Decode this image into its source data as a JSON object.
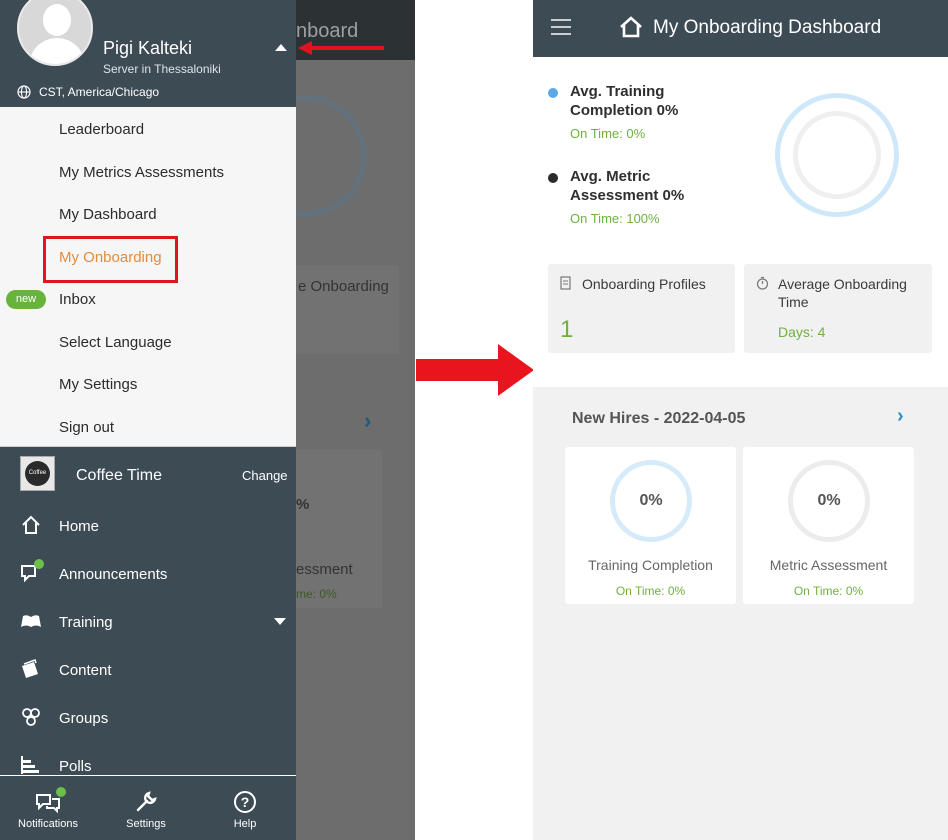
{
  "background_app": {
    "header_title_fragment": "nboard",
    "tile_fragment": "e Onboarding",
    "ring_fragment": "%",
    "label_fragment": "essment",
    "sub_fragment": "me: 0%"
  },
  "drawer": {
    "profile": {
      "name": "Pigi Kalteki",
      "server": "Server in Thessaloniki",
      "timezone": "CST, America/Chicago"
    },
    "menu_items": [
      {
        "label": "Leaderboard"
      },
      {
        "label": "My Metrics Assessments"
      },
      {
        "label": "My Dashboard"
      },
      {
        "label": "My Onboarding",
        "active": true,
        "highlighted": true
      },
      {
        "label": "Inbox",
        "badge": "new"
      },
      {
        "label": "Select Language"
      },
      {
        "label": "My Settings"
      },
      {
        "label": "Sign out"
      }
    ],
    "workspace": {
      "logo_text": "Coffee",
      "name": "Coffee Time",
      "change_label": "Change"
    },
    "nav_items": [
      {
        "label": "Home",
        "icon": "home-icon"
      },
      {
        "label": "Announcements",
        "icon": "megaphone-icon",
        "has_dot": true
      },
      {
        "label": "Training",
        "icon": "book-icon",
        "has_caret": true
      },
      {
        "label": "Content",
        "icon": "folder-icon"
      },
      {
        "label": "Groups",
        "icon": "groups-icon"
      },
      {
        "label": "Polls",
        "icon": "poll-icon"
      }
    ],
    "bottom_bar": [
      {
        "label": "Notifications",
        "icon": "chat-bubbles-icon"
      },
      {
        "label": "Settings",
        "icon": "wrench-icon"
      },
      {
        "label": "Help",
        "icon": "question-icon"
      }
    ]
  },
  "dashboard": {
    "title": "My Onboarding Dashboard",
    "stats": [
      {
        "title": "Avg. Training Completion 0%",
        "sub": "On Time: 0%",
        "dot_color": "#5aa9e6"
      },
      {
        "title": "Avg. Metric Assessment 0%",
        "sub": "On Time: 100%",
        "dot_color": "#2b2b2b"
      }
    ],
    "tiles": [
      {
        "label": "Onboarding Profiles",
        "value": "1"
      },
      {
        "label": "Average Onboarding Time",
        "value": "Days: 4"
      }
    ],
    "section": {
      "title": "New Hires - 2022-04-05",
      "cards": [
        {
          "value": "0%",
          "label": "Training Completion",
          "sub": "On Time: 0%"
        },
        {
          "value": "0%",
          "label": "Metric Assessment",
          "sub": "On Time: 0%"
        }
      ]
    }
  },
  "colors": {
    "drawer_bg": "#3d4b55",
    "accent_orange": "#e58a3a",
    "highlight_red": "#e0131e",
    "green": "#6fb13e",
    "link_blue": "#2a8fd2"
  }
}
